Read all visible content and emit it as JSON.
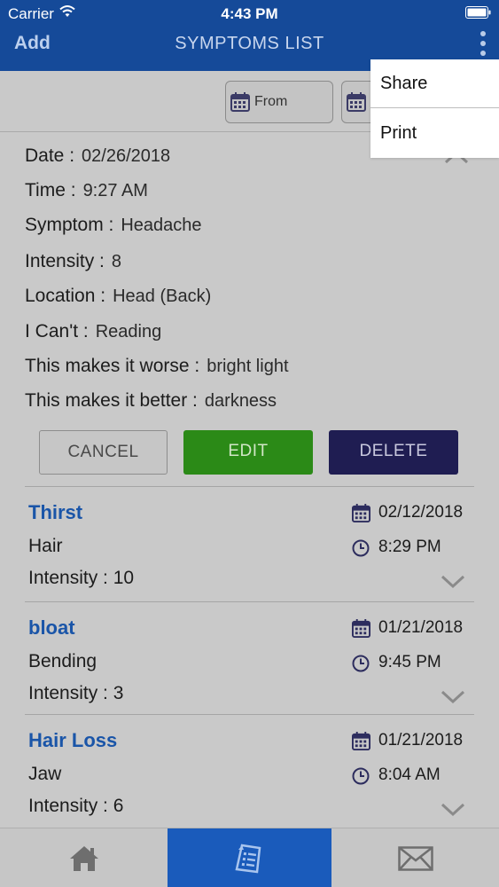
{
  "status_bar": {
    "carrier": "Carrier",
    "time": "4:43 PM"
  },
  "nav": {
    "add_label": "Add",
    "title": "SYMPTOMS LIST"
  },
  "filter": {
    "from_label": "From"
  },
  "menu": {
    "share_label": "Share",
    "print_label": "Print"
  },
  "detail": {
    "date_label": "Date :",
    "date_value": "02/26/2018",
    "time_label": "Time :",
    "time_value": "9:27 AM",
    "symptom_label": "Symptom :",
    "symptom_value": "Headache",
    "intensity_label": "Intensity :",
    "intensity_value": "8",
    "location_label": "Location :",
    "location_value": "Head (Back)",
    "cant_label": "I Can't :",
    "cant_value": "Reading",
    "worse_label": "This makes it worse :",
    "worse_value": "bright light",
    "better_label": "This makes it better :",
    "better_value": "darkness",
    "cancel_label": "CANCEL",
    "edit_label": "EDIT",
    "delete_label": "DELETE"
  },
  "entries": [
    {
      "title": "Thirst",
      "location": "Hair",
      "intensity": "Intensity : 10",
      "date": "02/12/2018",
      "time": "8:29 PM"
    },
    {
      "title": "bloat",
      "location": "Bending",
      "intensity": "Intensity : 3",
      "date": "01/21/2018",
      "time": "9:45 PM"
    },
    {
      "title": "Hair Loss",
      "location": "Jaw",
      "intensity": "Intensity : 6",
      "date": "01/21/2018",
      "time": "8:04 AM"
    }
  ],
  "colors": {
    "header": "#154a99",
    "title_blue": "#1a55a8",
    "edit": "#2b8a17",
    "delete": "#1f1d52",
    "tab_active": "#1a5bbb"
  },
  "icons": [
    "wifi-icon",
    "battery-icon",
    "more-vertical-icon",
    "calendar-icon",
    "clock-icon",
    "chevron-up-icon",
    "chevron-down-icon",
    "home-icon",
    "document-icon",
    "mail-icon"
  ]
}
